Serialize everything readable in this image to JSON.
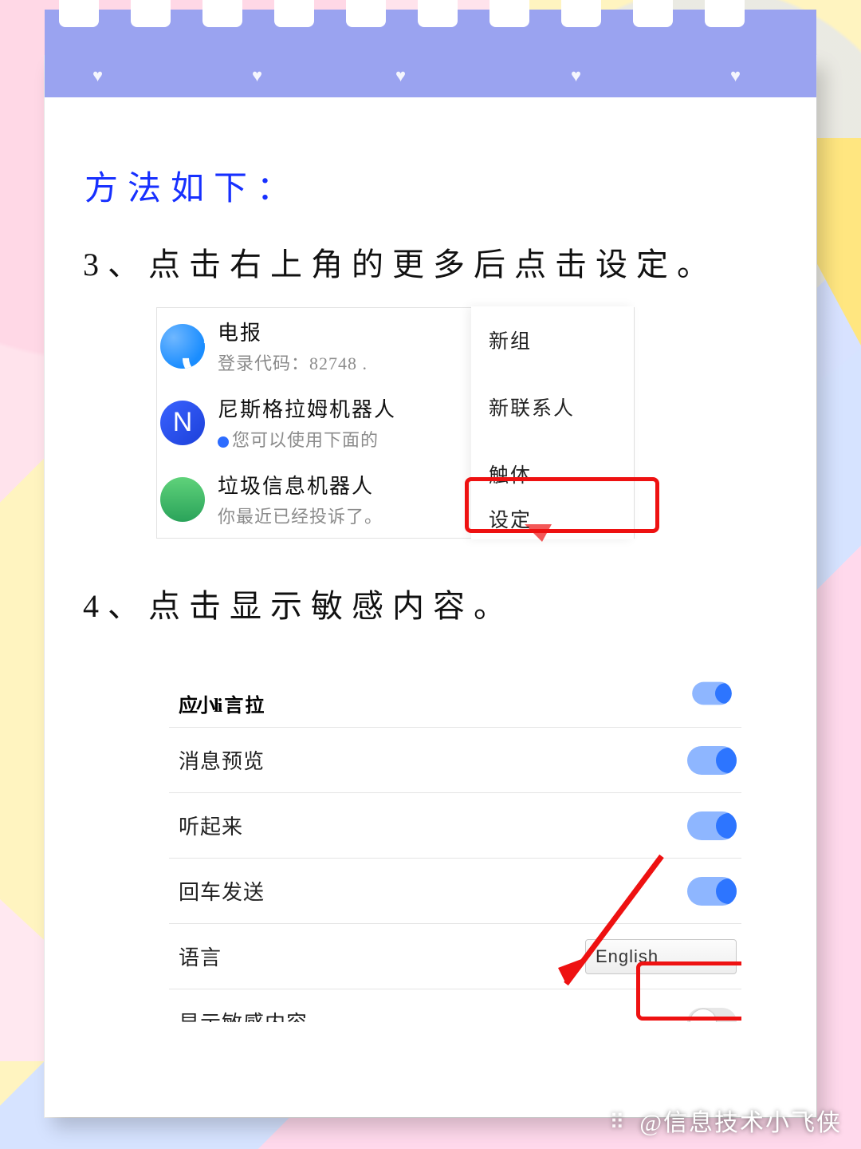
{
  "title": "方法如下：",
  "steps": {
    "s3": "3、点击右上角的更多后点击设定。",
    "s4": "4、点击显示敏感内容。"
  },
  "shot1": {
    "chats": [
      {
        "name": "电报",
        "sub": "登录代码：82748 ."
      },
      {
        "name": "尼斯格拉姆机器人",
        "sub": "您可以使用下面的"
      },
      {
        "name": "垃圾信息机器人",
        "sub": "你最近已经投诉了。"
      }
    ],
    "avatar_n": "N",
    "menu": [
      "新组",
      "新联系人",
      "触体",
      "设定"
    ]
  },
  "shot2": {
    "row0": "应⼩li 言 拉",
    "rows": [
      {
        "label": "消息预览",
        "toggle": "on"
      },
      {
        "label": "听起来",
        "toggle": "on"
      },
      {
        "label": "回车发送",
        "toggle": "on"
      },
      {
        "label": "语言",
        "value": "English"
      },
      {
        "label": "显示敏感内容",
        "toggle": "off",
        "highlighted": true
      }
    ]
  },
  "watermark": "@信息技术小飞侠"
}
